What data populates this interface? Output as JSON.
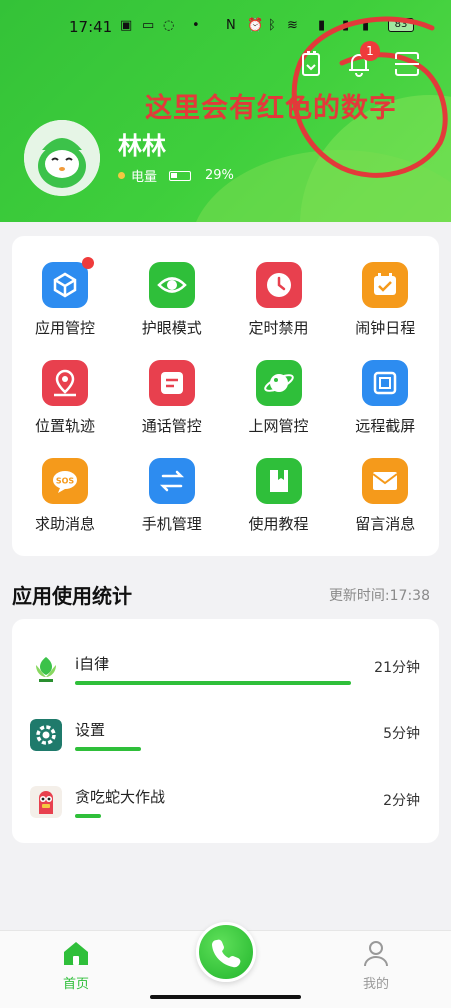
{
  "status_bar": {
    "time": "17:41",
    "battery": "83"
  },
  "header": {
    "user_name": "林林",
    "battery_label": "电量",
    "battery_percent": "29%",
    "battery_level": 0.29,
    "notification_count": "1",
    "annotation": "这里会有红色的数字"
  },
  "features": [
    {
      "label": "应用管控",
      "icon": "cube-icon",
      "color": "#2d8cf0",
      "badge": true
    },
    {
      "label": "护眼模式",
      "icon": "eye-icon",
      "color": "#2fbf3a",
      "badge": false
    },
    {
      "label": "定时禁用",
      "icon": "clock-icon",
      "color": "#e8404e",
      "badge": false
    },
    {
      "label": "闹钟日程",
      "icon": "calendar-check-icon",
      "color": "#f59a1b",
      "badge": false
    },
    {
      "label": "位置轨迹",
      "icon": "location-icon",
      "color": "#e8404e",
      "badge": false
    },
    {
      "label": "通话管控",
      "icon": "message-icon",
      "color": "#e8404e",
      "badge": false
    },
    {
      "label": "上网管控",
      "icon": "planet-icon",
      "color": "#2fbf3a",
      "badge": false
    },
    {
      "label": "远程截屏",
      "icon": "screenshot-icon",
      "color": "#2d8cf0",
      "badge": false
    },
    {
      "label": "求助消息",
      "icon": "sos-icon",
      "color": "#f59a1b",
      "badge": false
    },
    {
      "label": "手机管理",
      "icon": "transfer-icon",
      "color": "#2d8cf0",
      "badge": false
    },
    {
      "label": "使用教程",
      "icon": "book-icon",
      "color": "#2fbf3a",
      "badge": false
    },
    {
      "label": "留言消息",
      "icon": "envelope-icon",
      "color": "#f59a1b",
      "badge": false
    }
  ],
  "stats": {
    "title": "应用使用统计",
    "update_time": "更新时间:17:38",
    "apps": [
      {
        "name": "i自律",
        "time": "21分钟",
        "minutes": 21,
        "icon": "izilv-app-icon"
      },
      {
        "name": "设置",
        "time": "5分钟",
        "minutes": 5,
        "icon": "settings-app-icon"
      },
      {
        "name": "贪吃蛇大作战",
        "time": "2分钟",
        "minutes": 2,
        "icon": "snake-game-app-icon"
      }
    ]
  },
  "nav": {
    "home": "首页",
    "me": "我的"
  },
  "colors": {
    "primary": "#2fbf3a",
    "annotation_red": "#e23a3a",
    "badge_red": "#ef3b3b"
  }
}
